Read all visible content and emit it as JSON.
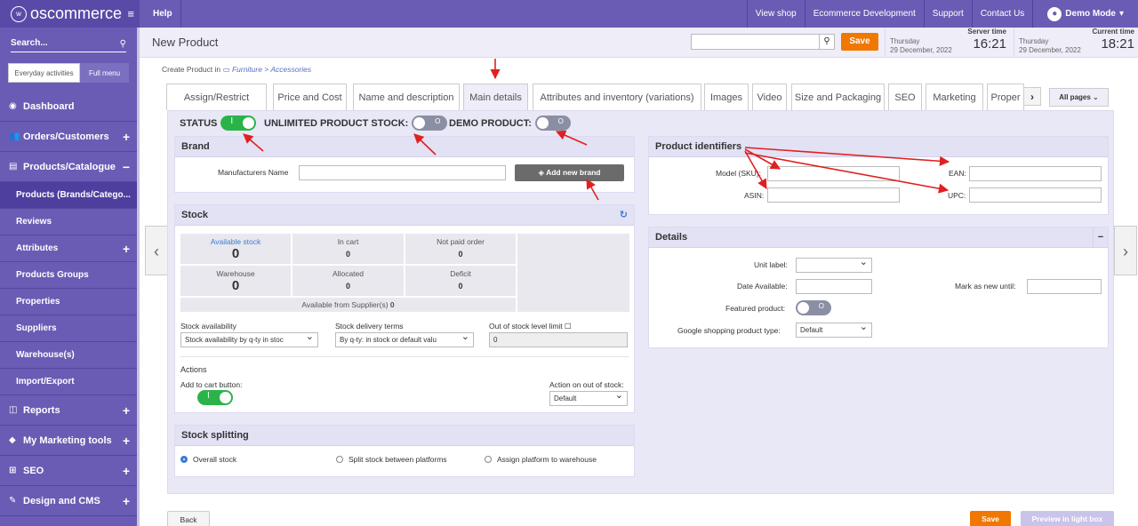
{
  "topbar": {
    "logo": "oscommerce",
    "help": "Help",
    "nav": [
      "View shop",
      "Ecommerce Development",
      "Support",
      "Contact Us"
    ],
    "user": "Demo Mode"
  },
  "sidebar": {
    "search": "Search...",
    "toggle_a": "Everyday activities",
    "toggle_b": "Full menu",
    "items": [
      {
        "label": "Dashboard",
        "icon": "dashboard-icon",
        "glyph": "◉",
        "plus": ""
      },
      {
        "label": "Orders/Customers",
        "icon": "users-icon",
        "glyph": "👥",
        "plus": "+"
      },
      {
        "label": "Products/Catalogue",
        "icon": "tag-icon",
        "glyph": "▤",
        "plus": "−"
      }
    ],
    "subitems": [
      "Products (Brands/Catego...",
      "Reviews",
      "Attributes",
      "Products Groups",
      "Properties",
      "Suppliers",
      "Warehouse(s)",
      "Import/Export"
    ],
    "items2": [
      {
        "label": "Reports",
        "icon": "chart-icon",
        "glyph": "◫",
        "plus": "+"
      },
      {
        "label": "My Marketing tools",
        "icon": "diamond-icon",
        "glyph": "◆",
        "plus": "+"
      },
      {
        "label": "SEO",
        "icon": "sitemap-icon",
        "glyph": "⊞",
        "plus": "+"
      },
      {
        "label": "Design and CMS",
        "icon": "brush-icon",
        "glyph": "✎",
        "plus": "+"
      }
    ]
  },
  "header": {
    "title": "New Product",
    "save": "Save",
    "server_label": "Server time",
    "server_day": "Thursday",
    "server_date": "29 December, 2022",
    "server_time": "16:21",
    "current_label": "Current time",
    "current_day": "Thursday",
    "current_date": "29 December, 2022",
    "current_time": "18:21"
  },
  "crumb": {
    "prefix": "Create Product in",
    "cat": "Furniture > Accessories"
  },
  "tabs": [
    "Assign/Restrict",
    "Price and Cost",
    "Name and description",
    "Main details",
    "Attributes and inventory (variations)",
    "Images",
    "Video",
    "Size and Packaging",
    "SEO",
    "Marketing",
    "Proper"
  ],
  "all_pages": "All pages",
  "status": {
    "status": "STATUS",
    "unlimited": "UNLIMITED PRODUCT STOCK:",
    "demo": "DEMO PRODUCT:",
    "on_mark": "I",
    "off_mark": "O"
  },
  "brand": {
    "title": "Brand",
    "manufacturer_label": "Manufacturers Name",
    "add_button": "Add new brand"
  },
  "stock": {
    "title": "Stock",
    "cells": [
      {
        "t": "Available stock",
        "v": "0"
      },
      {
        "t": "In cart",
        "v": "0"
      },
      {
        "t": "Not paid order",
        "v": "0"
      },
      {
        "t": "Warehouse",
        "v": "0"
      },
      {
        "t": "Allocated",
        "v": "0"
      },
      {
        "t": "Deficit",
        "v": "0"
      }
    ],
    "supplier_label": "Available from Supplier(s)",
    "supplier_value": "0",
    "availability_label": "Stock availability",
    "availability_value": "Stock availability by q-ty in stoc",
    "delivery_label": "Stock delivery terms",
    "delivery_value": "By q-ty: in stock or default valu",
    "limit_label": "Out of stock level limit",
    "limit_value": "0",
    "actions_title": "Actions",
    "cart_label": "Add to cart button:",
    "oos_label": "Action on out of stock:",
    "oos_value": "Default"
  },
  "splitting": {
    "title": "Stock splitting",
    "options": [
      "Overall stock",
      "Split stock between platforms",
      "Assign platform to warehouse"
    ]
  },
  "identifiers": {
    "title": "Product identifiers",
    "model": "Model (SKU):",
    "ean": "EAN:",
    "asin": "ASIN:",
    "upc": "UPC:"
  },
  "details": {
    "title": "Details",
    "collapse": "−",
    "unit_label": "Unit label:",
    "date_label": "Date Available:",
    "mark_new": "Mark as new until:",
    "featured": "Featured product:",
    "google": "Google shopping product type:",
    "google_value": "Default"
  },
  "footer": {
    "back": "Back",
    "save": "Save",
    "preview": "Preview in light box"
  }
}
